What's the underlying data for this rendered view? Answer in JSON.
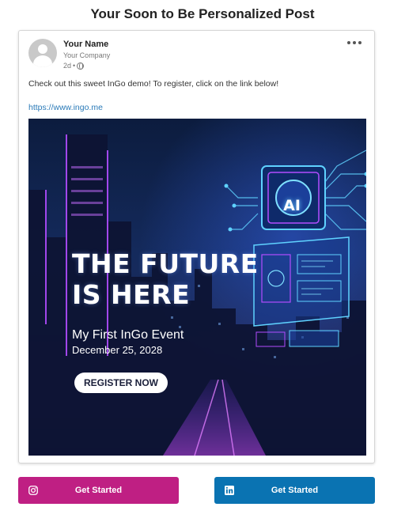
{
  "page": {
    "title": "Your Soon to Be Personalized Post"
  },
  "post": {
    "author_name": "Your Name",
    "author_company": "Your Company",
    "timestamp": "2d",
    "meta_separator": "•",
    "text": "Check out this sweet InGo demo! To register, click on the link below!",
    "link": "https://www.ingo.me"
  },
  "image": {
    "headline": "THE FUTURE IS HERE",
    "event_name": "My First InGo Event",
    "event_date": "December 25, 2028",
    "register_label": "REGISTER NOW",
    "chip_label": "AI",
    "accent_color": "#b24cff",
    "circuit_color": "#5fd2ff"
  },
  "actions": [
    {
      "label": "Get Started",
      "icon": "instagram-icon",
      "color": "#bf1f83"
    },
    {
      "label": "Get Started",
      "icon": "linkedin-icon",
      "color": "#0a73b2"
    }
  ]
}
